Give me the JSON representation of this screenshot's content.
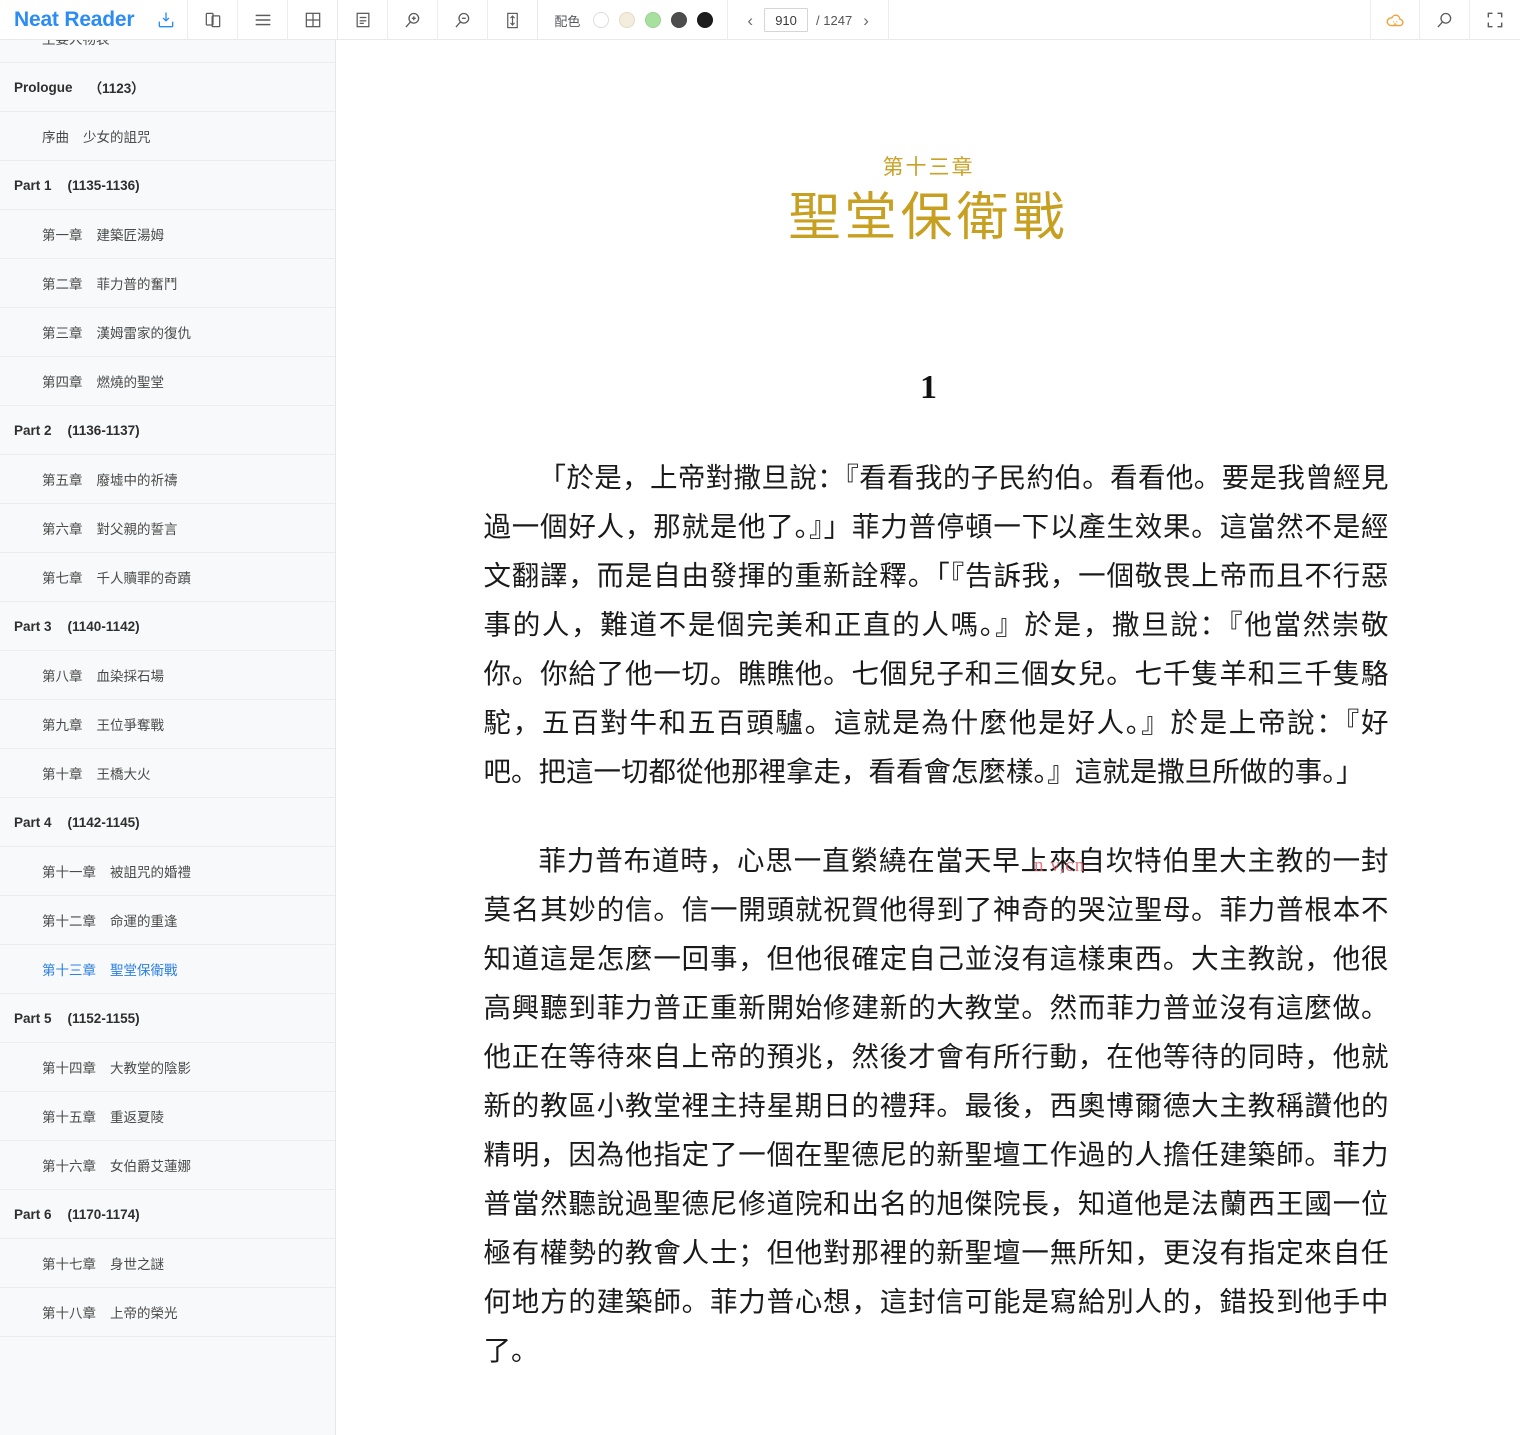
{
  "app": {
    "name": "Neat Reader"
  },
  "toolbar": {
    "save_icon": "save-icon",
    "icons": [
      {
        "name": "two-page-view-icon",
        "label": "兩頁檢視"
      },
      {
        "name": "menu-icon",
        "label": "目錄"
      },
      {
        "name": "grid-layout-icon",
        "label": "格線版面"
      },
      {
        "name": "single-page-icon",
        "label": "單頁版面"
      },
      {
        "name": "zoom-in-icon",
        "label": "放大"
      },
      {
        "name": "zoom-out-icon",
        "label": "縮小"
      },
      {
        "name": "fit-height-icon",
        "label": "適合高度"
      }
    ],
    "color_scheme": {
      "label": "配色",
      "swatches": [
        {
          "name": "white",
          "hex": "#ffffff",
          "selected": false
        },
        {
          "name": "cream",
          "hex": "#f4ecdc",
          "selected": false
        },
        {
          "name": "green",
          "hex": "#a8e0a0",
          "selected": false
        },
        {
          "name": "gray",
          "hex": "#4d4d4d",
          "selected": false
        },
        {
          "name": "black",
          "hex": "#1d1d1d",
          "selected": false
        }
      ]
    },
    "pager": {
      "prev": "‹",
      "next": "›",
      "current_page": "910",
      "total_label": "/ 1247"
    },
    "right_icons": [
      {
        "name": "cloud-sync-icon",
        "color": "#f0a135"
      },
      {
        "name": "search-icon",
        "color": "#5b5b5b"
      },
      {
        "name": "fullscreen-icon",
        "color": "#5b5b5b"
      }
    ]
  },
  "sidebar": {
    "items": [
      {
        "type": "chapter",
        "num": "",
        "title": "主要人物表",
        "active": false
      },
      {
        "type": "part",
        "label": "Prologue",
        "range": "（1123）",
        "active": false
      },
      {
        "type": "chapter",
        "num": "序曲",
        "title": "少女的詛咒",
        "active": false
      },
      {
        "type": "part",
        "label": "Part 1",
        "range": "(1135-1136)",
        "active": false
      },
      {
        "type": "chapter",
        "num": "第一章",
        "title": "建築匠湯姆",
        "active": false
      },
      {
        "type": "chapter",
        "num": "第二章",
        "title": "菲力普的奮鬥",
        "active": false
      },
      {
        "type": "chapter",
        "num": "第三章",
        "title": "漢姆雷家的復仇",
        "active": false
      },
      {
        "type": "chapter",
        "num": "第四章",
        "title": "燃燒的聖堂",
        "active": false
      },
      {
        "type": "part",
        "label": "Part 2",
        "range": "(1136-1137)",
        "active": false
      },
      {
        "type": "chapter",
        "num": "第五章",
        "title": "廢墟中的祈禱",
        "active": false
      },
      {
        "type": "chapter",
        "num": "第六章",
        "title": "對父親的誓言",
        "active": false
      },
      {
        "type": "chapter",
        "num": "第七章",
        "title": "千人贖罪的奇蹟",
        "active": false
      },
      {
        "type": "part",
        "label": "Part 3",
        "range": "(1140-1142)",
        "active": false
      },
      {
        "type": "chapter",
        "num": "第八章",
        "title": "血染採石場",
        "active": false
      },
      {
        "type": "chapter",
        "num": "第九章",
        "title": "王位爭奪戰",
        "active": false
      },
      {
        "type": "chapter",
        "num": "第十章",
        "title": "王橋大火",
        "active": false
      },
      {
        "type": "part",
        "label": "Part 4",
        "range": "(1142-1145)",
        "active": false
      },
      {
        "type": "chapter",
        "num": "第十一章",
        "title": "被詛咒的婚禮",
        "active": false
      },
      {
        "type": "chapter",
        "num": "第十二章",
        "title": "命運的重逢",
        "active": false
      },
      {
        "type": "chapter",
        "num": "第十三章",
        "title": "聖堂保衛戰",
        "active": true
      },
      {
        "type": "part",
        "label": "Part 5",
        "range": "(1152-1155)",
        "active": false
      },
      {
        "type": "chapter",
        "num": "第十四章",
        "title": "大教堂的陰影",
        "active": false
      },
      {
        "type": "chapter",
        "num": "第十五章",
        "title": "重返夏陵",
        "active": false
      },
      {
        "type": "chapter",
        "num": "第十六章",
        "title": "女伯爵艾蓮娜",
        "active": false
      },
      {
        "type": "part",
        "label": "Part 6",
        "range": "(1170-1174)",
        "active": false
      },
      {
        "type": "chapter",
        "num": "第十七章",
        "title": "身世之謎",
        "active": false
      },
      {
        "type": "chapter",
        "num": "第十八章",
        "title": "上帝的榮光",
        "active": false
      }
    ]
  },
  "reader": {
    "chapter_number": "第十三章",
    "chapter_title": "聖堂保衛戰",
    "section_number": "1",
    "paragraphs": [
      "「於是，上帝對撒旦說：『看看我的子民約伯。看看他。要是我曾經見過一個好人，那就是他了。』」菲力普停頓一下以產生效果。這當然不是經文翻譯，而是自由發揮的重新詮釋。「『告訴我，一個敬畏上帝而且不行惡事的人，難道不是個完美和正直的人嗎。』於是，撒旦說：『他當然崇敬你。你給了他一切。瞧瞧他。七個兒子和三個女兒。七千隻羊和三千隻駱駝，五百對牛和五百頭驢。這就是為什麼他是好人。』於是上帝說：『好吧。把這一切都從他那裡拿走，看看會怎麼樣。』這就是撒旦所做的事。」",
      "菲力普布道時，心思一直縈繞在當天早上來自坎特伯里大主教的一封莫名其妙的信。信一開頭就祝賀他得到了神奇的哭泣聖母。菲力普根本不知道這是怎麼一回事，但他很確定自己並沒有這樣東西。大主教說，他很高興聽到菲力普正重新開始修建新的大教堂。然而菲力普並沒有這麼做。他正在等待來自上帝的預兆，然後才會有所行動，在他等待的同時，他就新的教區小教堂裡主持星期日的禮拜。最後，西奧博爾德大主教稱讚他的精明，因為他指定了一個在聖德尼的新聖壇工作過的人擔任建築師。菲力普當然聽說過聖德尼修道院和出名的旭傑院長，知道他是法蘭西王國一位極有權勢的教會人士；但他對那裡的新聖壇一無所知，更沒有指定來自任何地方的建築師。菲力普心想，這封信可能是寫給別人的，錯投到他手中了。"
    ],
    "watermark": "n v,cn"
  }
}
